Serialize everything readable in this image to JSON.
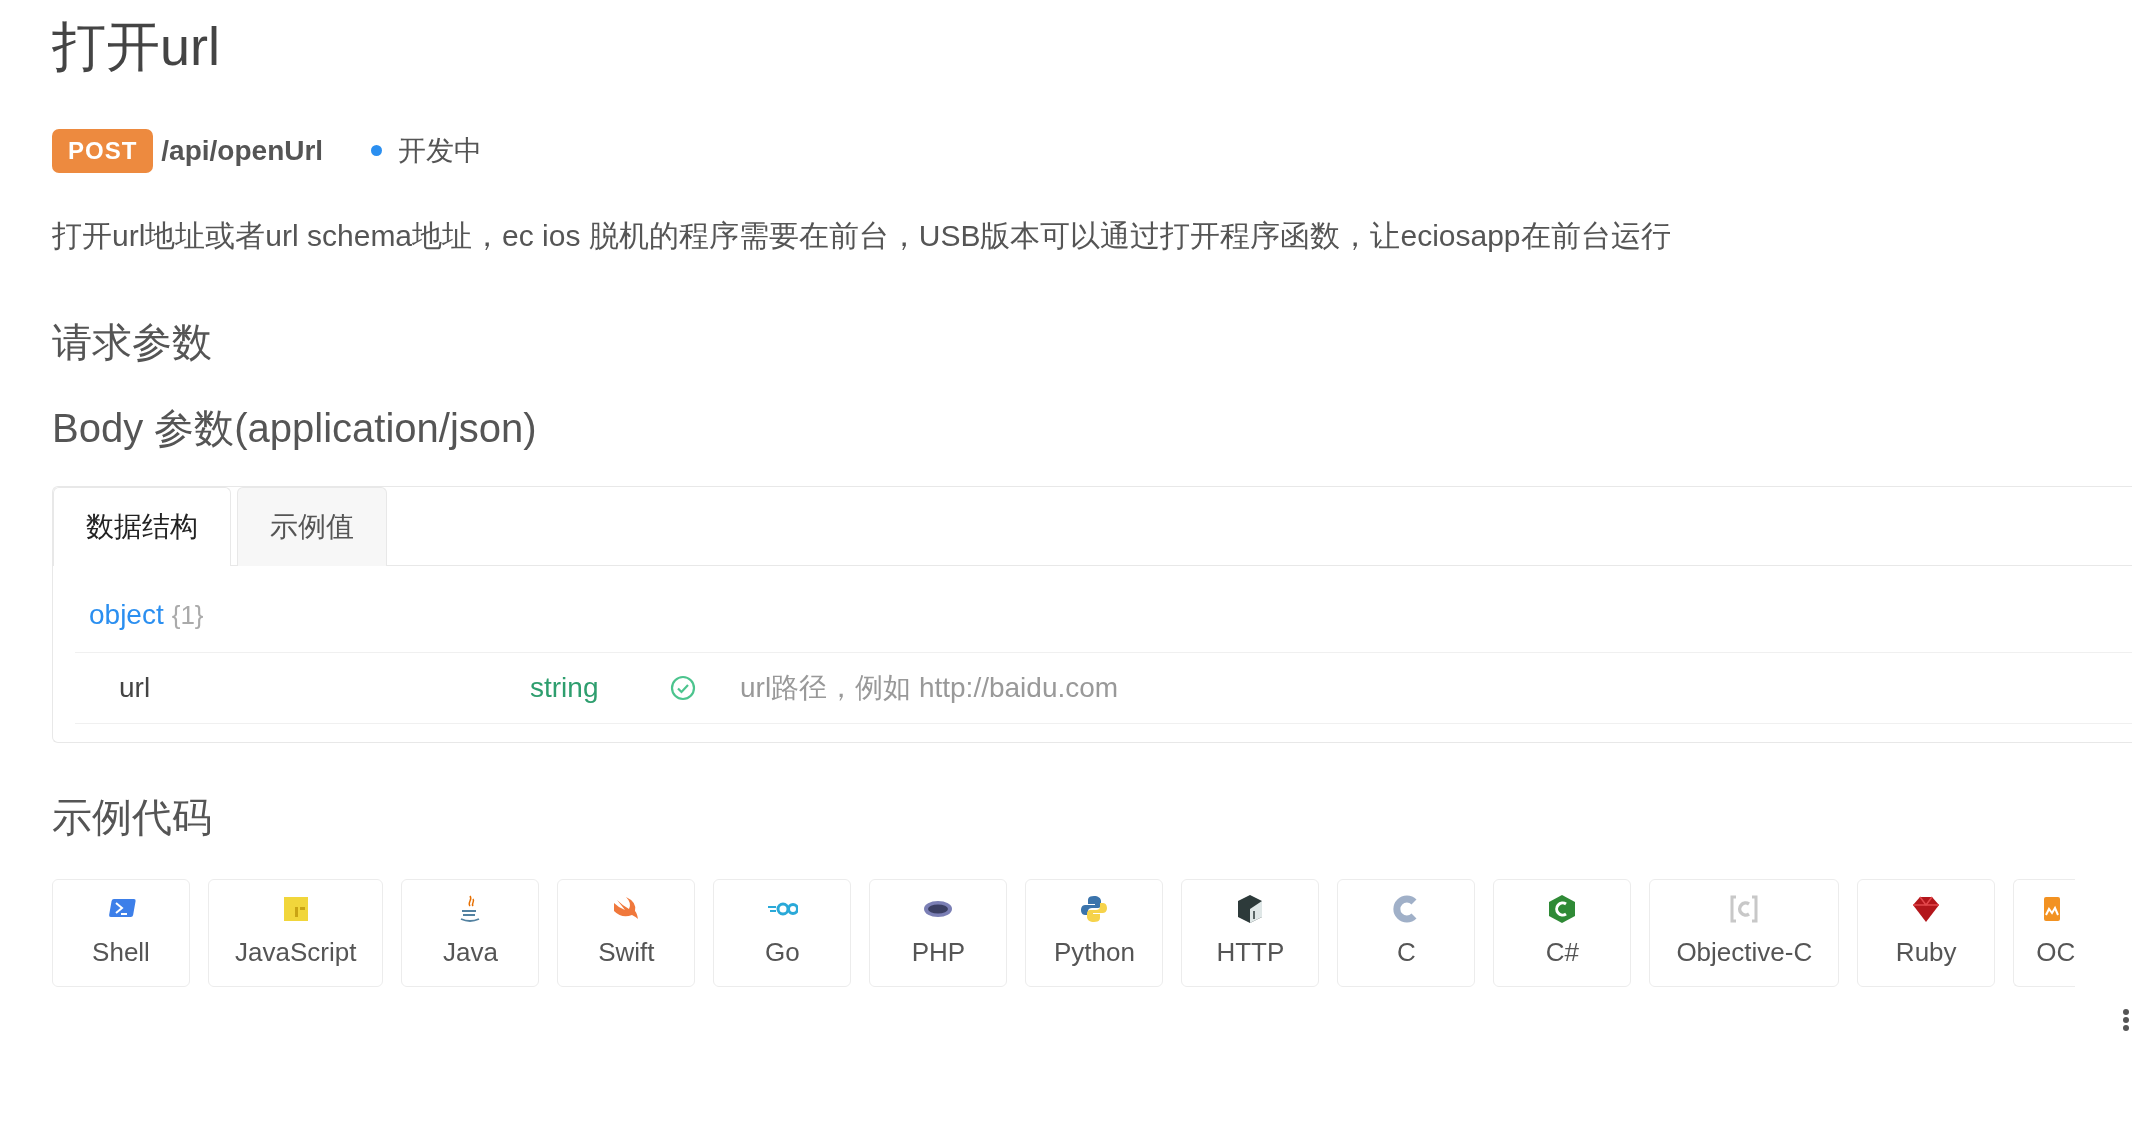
{
  "title": "打开url",
  "endpoint": {
    "method": "POST",
    "path": "/api/openUrl",
    "status": {
      "label": "开发中",
      "color": "#2b8ff0"
    }
  },
  "description": "打开url地址或者url schema地址，ec ios 脱机的程序需要在前台，USB版本可以通过打开程序函数，让eciosapp在前台运行",
  "request_heading": "请求参数",
  "body_heading": "Body 参数(application/json)",
  "tabs": [
    {
      "label": "数据结构",
      "selected": true
    },
    {
      "label": "示例值",
      "selected": false
    }
  ],
  "schema": {
    "type": "object",
    "count": "{1}",
    "fields": [
      {
        "name": "url",
        "type": "string",
        "required": true,
        "description": "url路径，例如 http://baidu.com"
      }
    ]
  },
  "code_heading": "示例代码",
  "languages": [
    {
      "label": "Shell",
      "kind": "shell"
    },
    {
      "label": "JavaScript",
      "kind": "js"
    },
    {
      "label": "Java",
      "kind": "java"
    },
    {
      "label": "Swift",
      "kind": "swift"
    },
    {
      "label": "Go",
      "kind": "go"
    },
    {
      "label": "PHP",
      "kind": "php"
    },
    {
      "label": "Python",
      "kind": "python"
    },
    {
      "label": "HTTP",
      "kind": "http"
    },
    {
      "label": "C",
      "kind": "c"
    },
    {
      "label": "C#",
      "kind": "csharp"
    },
    {
      "label": "Objective-C",
      "kind": "objc"
    },
    {
      "label": "Ruby",
      "kind": "ruby"
    },
    {
      "label": "OC",
      "kind": "ocaml"
    }
  ]
}
